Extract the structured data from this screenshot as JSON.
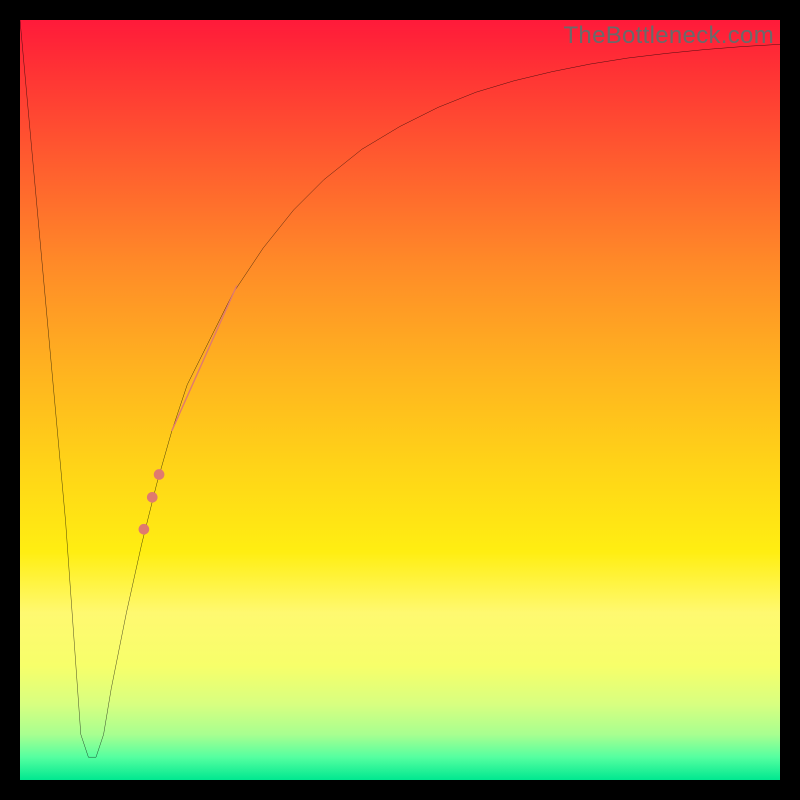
{
  "watermark": "TheBottleneck.com",
  "colors": {
    "frame": "#000000",
    "curve": "#000000",
    "marker": "#e07a6f",
    "gradient_top": "#ff1a3a",
    "gradient_bottom": "#00e890"
  },
  "chart_data": {
    "type": "line",
    "title": "",
    "xlabel": "",
    "ylabel": "",
    "xlim": [
      0,
      100
    ],
    "ylim": [
      0,
      100
    ],
    "grid": false,
    "legend": false,
    "series": [
      {
        "name": "bottleneck-curve",
        "x": [
          0,
          2,
          4,
          6,
          7,
          8,
          9,
          10,
          11,
          12,
          14,
          16,
          18,
          20,
          22,
          25,
          28,
          32,
          36,
          40,
          45,
          50,
          55,
          60,
          65,
          70,
          75,
          80,
          85,
          90,
          95,
          100
        ],
        "y": [
          100,
          78,
          56,
          34,
          20,
          6,
          3,
          3,
          6,
          12,
          22,
          31,
          39,
          46,
          52,
          58,
          64,
          70,
          75,
          79,
          83,
          86,
          88.5,
          90.5,
          92,
          93.2,
          94.2,
          95,
          95.6,
          96.1,
          96.5,
          96.8
        ]
      }
    ],
    "markers": {
      "name": "highlight-segment",
      "description": "Salmon segment and dots along the rising curve",
      "thick_segment": {
        "x": [
          20,
          28.5
        ],
        "y": [
          46,
          65
        ]
      },
      "dots": [
        {
          "x": 18.3,
          "y": 40.2
        },
        {
          "x": 17.4,
          "y": 37.2
        },
        {
          "x": 16.3,
          "y": 33.0
        }
      ]
    },
    "notes": "X/Y are percent of inner plot width/height (0,0 bottom-left). Values estimated from pixels; no axis ticks or labels are shown."
  }
}
